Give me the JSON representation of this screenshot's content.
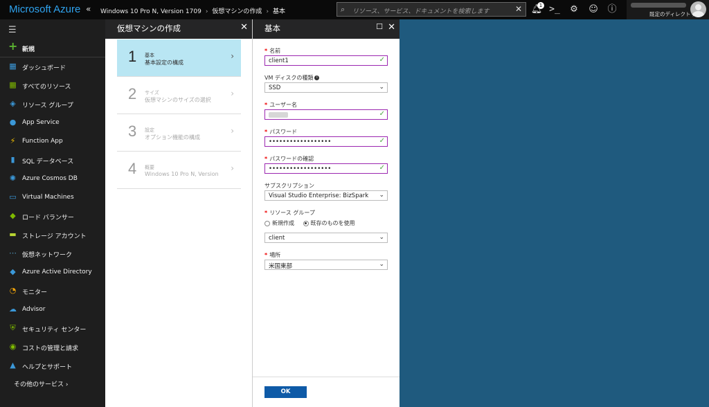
{
  "topbar": {
    "brand": "Microsoft Azure",
    "collapse_icon": "«",
    "breadcrumbs": [
      "Windows 10 Pro N, Version 1709",
      "仮想マシンの作成",
      "基本"
    ],
    "search_placeholder": "リソース、サービス、ドキュメントを検索します",
    "notification_count": "1",
    "directory": "既定のディレクトリ"
  },
  "nav": {
    "items": [
      {
        "label": "新規",
        "icon": "plus-icon",
        "color": "#5cb531"
      },
      {
        "label": "ダッシュボード",
        "icon": "dashboard-icon",
        "color": "#3b98d8"
      },
      {
        "label": "すべてのリソース",
        "icon": "grid-icon",
        "color": "#7fba00"
      },
      {
        "label": "リソース グループ",
        "icon": "resource-group-icon",
        "color": "#3b98d8"
      },
      {
        "label": "App Service",
        "icon": "app-service-icon",
        "color": "#3b98d8"
      },
      {
        "label": "Function App",
        "icon": "function-icon",
        "color": "#f5c200"
      },
      {
        "label": "SQL データベース",
        "icon": "sql-icon",
        "color": "#3b98d8"
      },
      {
        "label": "Azure Cosmos DB",
        "icon": "cosmos-icon",
        "color": "#3b98d8"
      },
      {
        "label": "Virtual Machines",
        "icon": "vm-icon",
        "color": "#3b98d8"
      },
      {
        "label": "ロード バランサー",
        "icon": "load-balancer-icon",
        "color": "#7fba00"
      },
      {
        "label": "ストレージ アカウント",
        "icon": "storage-icon",
        "color": "#b8d432"
      },
      {
        "label": "仮想ネットワーク",
        "icon": "vnet-icon",
        "color": "#55a0c8"
      },
      {
        "label": "Azure Active Directory",
        "icon": "aad-icon",
        "color": "#3b98d8"
      },
      {
        "label": "モニター",
        "icon": "monitor-icon",
        "color": "#f0a30a"
      },
      {
        "label": "Advisor",
        "icon": "advisor-icon",
        "color": "#3b98d8"
      },
      {
        "label": "セキュリティ センター",
        "icon": "shield-icon",
        "color": "#7fba00"
      },
      {
        "label": "コストの管理と請求",
        "icon": "cost-icon",
        "color": "#7fba00"
      },
      {
        "label": "ヘルプとサポート",
        "icon": "help-person-icon",
        "color": "#3b98d8"
      }
    ],
    "more": "その他のサービス"
  },
  "blade1": {
    "title": "仮想マシンの作成",
    "steps": [
      {
        "num": "1",
        "title": "基本",
        "subtitle": "基本設定の構成"
      },
      {
        "num": "2",
        "title": "サイズ",
        "subtitle": "仮想マシンのサイズの選択"
      },
      {
        "num": "3",
        "title": "設定",
        "subtitle": "オプション機能の構成"
      },
      {
        "num": "4",
        "title": "概要",
        "subtitle": "Windows 10 Pro N, Version 1709"
      }
    ]
  },
  "blade2": {
    "title": "基本",
    "name_label": "名前",
    "name_value": "client1",
    "disk_label": "VM ディスクの種類",
    "disk_value": "SSD",
    "user_label": "ユーザー名",
    "password_label": "パスワード",
    "password_value": "••••••••••••••••••",
    "confirm_label": "パスワードの確認",
    "confirm_value": "••••••••••••••••••",
    "subscription_label": "サブスクリプション",
    "subscription_value": "Visual Studio Enterprise: BizSpark",
    "rg_label": "リソース グループ",
    "rg_new": "新規作成",
    "rg_existing": "既存のものを使用",
    "rg_value": "client",
    "location_label": "場所",
    "location_value": "米国東部",
    "ok": "OK"
  }
}
